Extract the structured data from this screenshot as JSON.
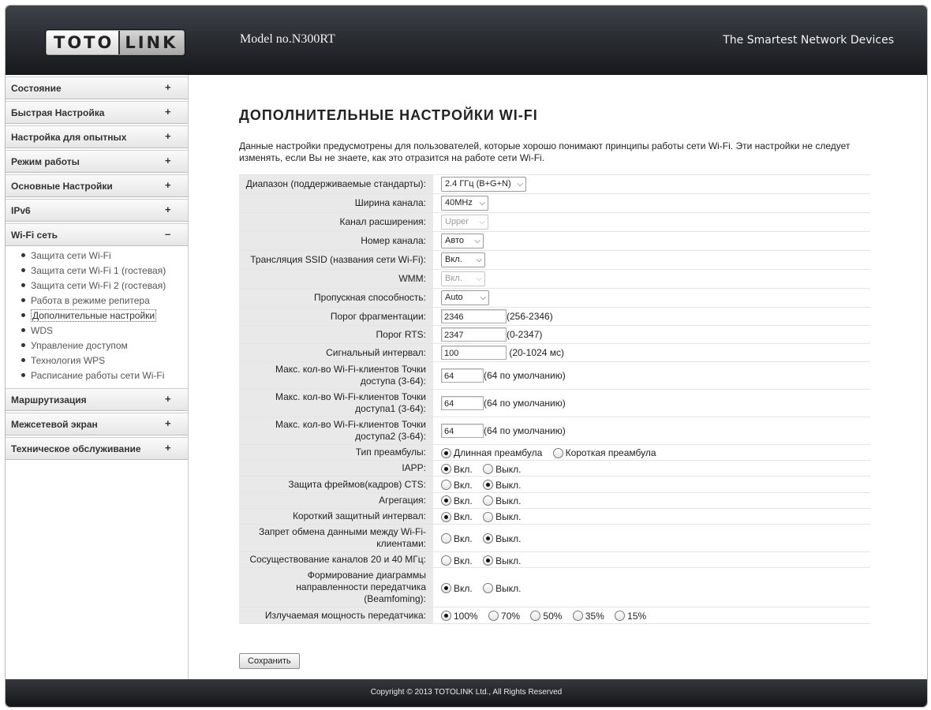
{
  "header": {
    "logo_left": "TOTO",
    "logo_right": "LINK",
    "model": "Model no.N300RT",
    "tagline": "The Smartest Network Devices"
  },
  "sidebar": {
    "items_top": [
      {
        "label": "Состояние",
        "toggle": "+"
      },
      {
        "label": "Быстрая Настройка",
        "toggle": "+"
      },
      {
        "label": "Настройка для опытных",
        "toggle": "+"
      },
      {
        "label": "Режим работы",
        "toggle": "+"
      },
      {
        "label": "Основные Настройки",
        "toggle": "+"
      },
      {
        "label": "IPv6",
        "toggle": "+"
      }
    ],
    "wifi": {
      "label": "Wi-Fi сеть",
      "toggle": "–"
    },
    "wifi_sub": [
      "Защита сети Wi-Fi",
      "Защита сети Wi-Fi 1 (гостевая)",
      "Защита сети Wi-Fi 2 (гостевая)",
      "Работа в режиме репитера",
      "Дополнительные настройки",
      "WDS",
      "Управление доступом",
      "Технология WPS",
      "Расписание работы сети Wi-Fi"
    ],
    "active_sub": "Дополнительные настройки",
    "items_bottom": [
      {
        "label": "Маршрутизация",
        "toggle": "+"
      },
      {
        "label": "Межсетевой экран",
        "toggle": "+"
      },
      {
        "label": "Техническое обслуживание",
        "toggle": "+"
      }
    ]
  },
  "main": {
    "title": "ДОПОЛНИТЕЛЬНЫЕ НАСТРОЙКИ WI-FI",
    "description": "Данные настройки предусмотрены для пользователей, которые хорошо понимают принципы работы сети Wi-Fi. Эти настройки не следует изменять, если Вы не знаете, как это отразится на работе сети Wi-Fi.",
    "selects": {
      "band": {
        "label": "Диапазон (поддерживаемые стандарты):",
        "value": "2.4 ГГц (B+G+N)"
      },
      "channel_width": {
        "label": "Ширина канала:",
        "value": "40MHz"
      },
      "ext_channel": {
        "label": "Канал расширения:",
        "value": "Upper"
      },
      "channel_number": {
        "label": "Номер канала:",
        "value": "Авто"
      },
      "ssid_broadcast": {
        "label": "Трансляция SSID (названия сети Wi-Fi):",
        "value": "Вкл."
      },
      "wmm": {
        "label": "WMM:",
        "value": "Вкл."
      },
      "data_rate": {
        "label": "Пропускная способность:",
        "value": "Auto"
      }
    },
    "inputs": {
      "frag": {
        "label": "Порог фрагментации:",
        "value": "2346",
        "hint": "(256-2346)"
      },
      "rts": {
        "label": "Порог RTS:",
        "value": "2347",
        "hint": "(0-2347)"
      },
      "beacon": {
        "label": "Сигнальный интервал:",
        "value": "100",
        "hint": " (20-1024 мс)"
      },
      "max_clients": {
        "label": "Макс. кол-во Wi-Fi-клиентов Точки доступа (3-64):",
        "value": "64",
        "hint": "(64 по умолчанию)"
      },
      "max_clients1": {
        "label": "Макс. кол-во Wi-Fi-клиентов Точки доступа1 (3-64):",
        "value": "64",
        "hint": "(64 по умолчанию)"
      },
      "max_clients2": {
        "label": "Макс. кол-во Wi-Fi-клиентов Точки доступа2 (3-64):",
        "value": "64",
        "hint": "(64 по умолчанию)"
      }
    },
    "preamble": {
      "label": "Тип преамбулы:",
      "long": "Длинная преамбула",
      "short": "Короткая преамбула",
      "selected": "long"
    },
    "on_label": "Вкл.",
    "off_label": "Выкл.",
    "toggles": {
      "iapp": {
        "label": "IAPP:",
        "selected": "on"
      },
      "cts": {
        "label": "Защита фреймов(кадров) CTS:",
        "selected": "off"
      },
      "aggregation": {
        "label": "Агрегация:",
        "selected": "on"
      },
      "short_gi": {
        "label": "Короткий защитный интервал:",
        "selected": "on"
      },
      "isolation": {
        "label": "Запрет обмена данными между Wi-Fi-клиентами:",
        "selected": "off"
      },
      "coexist": {
        "label": "Сосуществование каналов 20 и 40 МГц:",
        "selected": "off"
      },
      "beamforming": {
        "label": "Формирование диаграммы направленности передатчика (Beamfoming):",
        "selected": "on"
      }
    },
    "tx_power": {
      "label": "Излучаемая мощность передатчика:",
      "options": [
        "100%",
        "70%",
        "50%",
        "35%",
        "15%"
      ],
      "selected": "100%"
    },
    "save_label": "Сохранить"
  },
  "footer": {
    "copyright": "Copyright © 2013 TOTOLINK Ltd.,   All Rights Reserved"
  }
}
